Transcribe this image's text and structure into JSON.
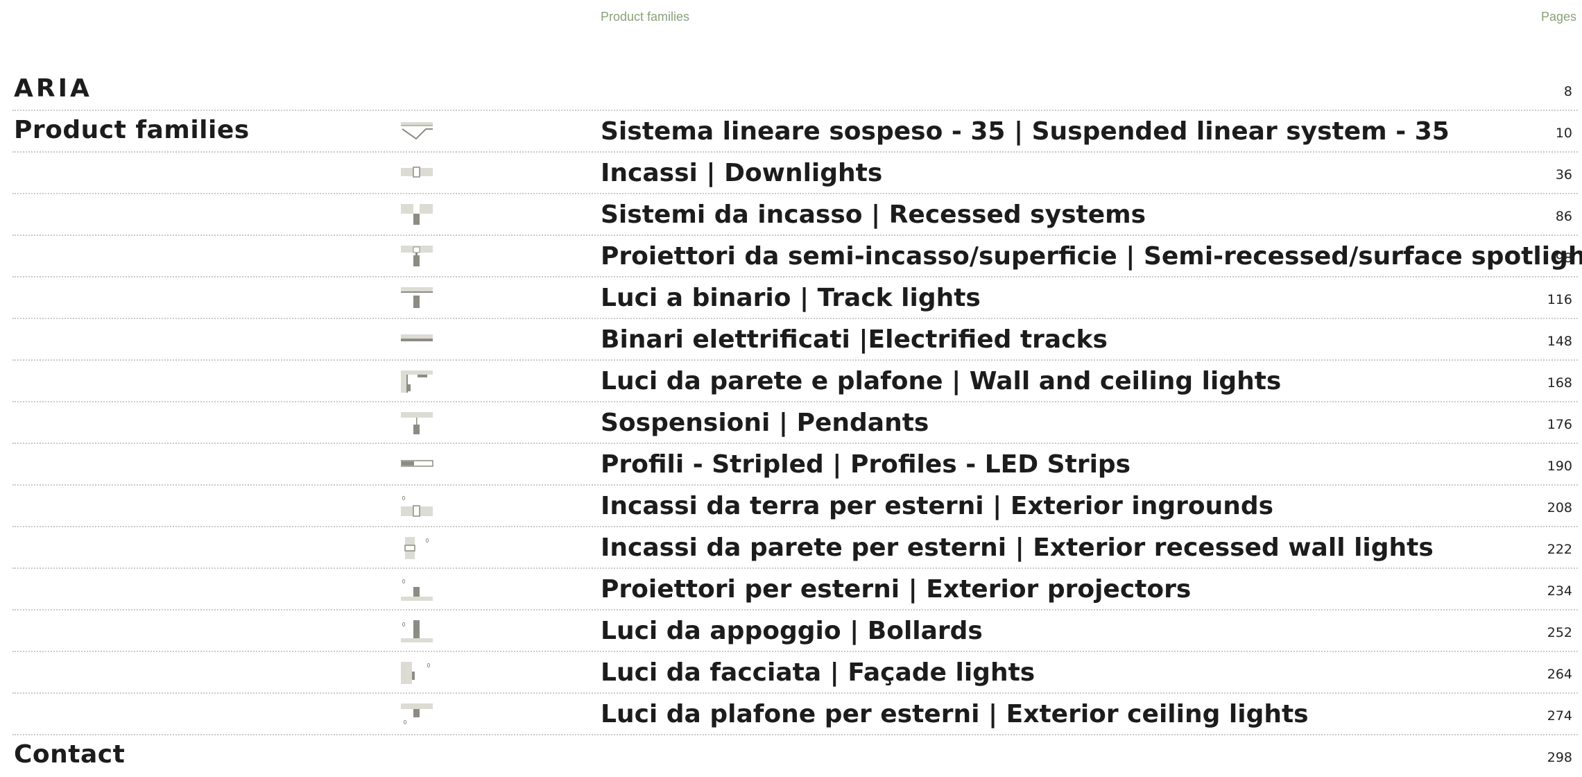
{
  "header": {
    "families_label": "Product families",
    "pages_label": "Pages"
  },
  "sections": {
    "aria": {
      "title": "ARIA",
      "page": "8"
    },
    "families": {
      "title": "Product families"
    },
    "contact": {
      "title": "Contact",
      "page": "298"
    }
  },
  "families": [
    {
      "icon": "suspended-linear-icon",
      "label": "Sistema lineare sospeso - 35 | Suspended linear system - 35",
      "page": "10"
    },
    {
      "icon": "downlight-icon",
      "label": "Incassi | Downlights",
      "page": "36"
    },
    {
      "icon": "recessed-system-icon",
      "label": "Sistemi da incasso | Recessed systems",
      "page": "86"
    },
    {
      "icon": "semi-recessed-spotlight-icon",
      "label": "Proiettori da semi-incasso/superficie | Semi-recessed/surface spotlights",
      "page": "98"
    },
    {
      "icon": "track-light-icon",
      "label": "Luci a binario | Track lights",
      "page": "116"
    },
    {
      "icon": "electrified-track-icon",
      "label": "Binari elettrificati |Electrified tracks",
      "page": "148"
    },
    {
      "icon": "wall-ceiling-light-icon",
      "label": "Luci da parete e plafone | Wall and ceiling lights",
      "page": "168"
    },
    {
      "icon": "pendant-icon",
      "label": "Sospensioni | Pendants",
      "page": "176"
    },
    {
      "icon": "led-strip-profile-icon",
      "label": "Profili - Stripled | Profiles - LED Strips",
      "page": "190"
    },
    {
      "icon": "exterior-inground-icon",
      "label": "Incassi da terra per esterni | Exterior ingrounds",
      "page": "208"
    },
    {
      "icon": "exterior-recessed-wall-icon",
      "label": "Incassi da parete per esterni | Exterior recessed wall lights",
      "page": "222"
    },
    {
      "icon": "exterior-projector-icon",
      "label": "Proiettori per esterni | Exterior projectors",
      "page": "234"
    },
    {
      "icon": "bollard-icon",
      "label": "Luci da appoggio | Bollards",
      "page": "252"
    },
    {
      "icon": "facade-light-icon",
      "label": "Luci da facciata | Façade lights",
      "page": "264"
    },
    {
      "icon": "exterior-ceiling-light-icon",
      "label": "Luci da plafone per esterni | Exterior ceiling lights",
      "page": "274"
    }
  ],
  "colors": {
    "header_green": "#8aa07a",
    "icon_fill": "#dcdcd4",
    "icon_dark": "#8c8c84",
    "divider": "#c9c9c9"
  }
}
